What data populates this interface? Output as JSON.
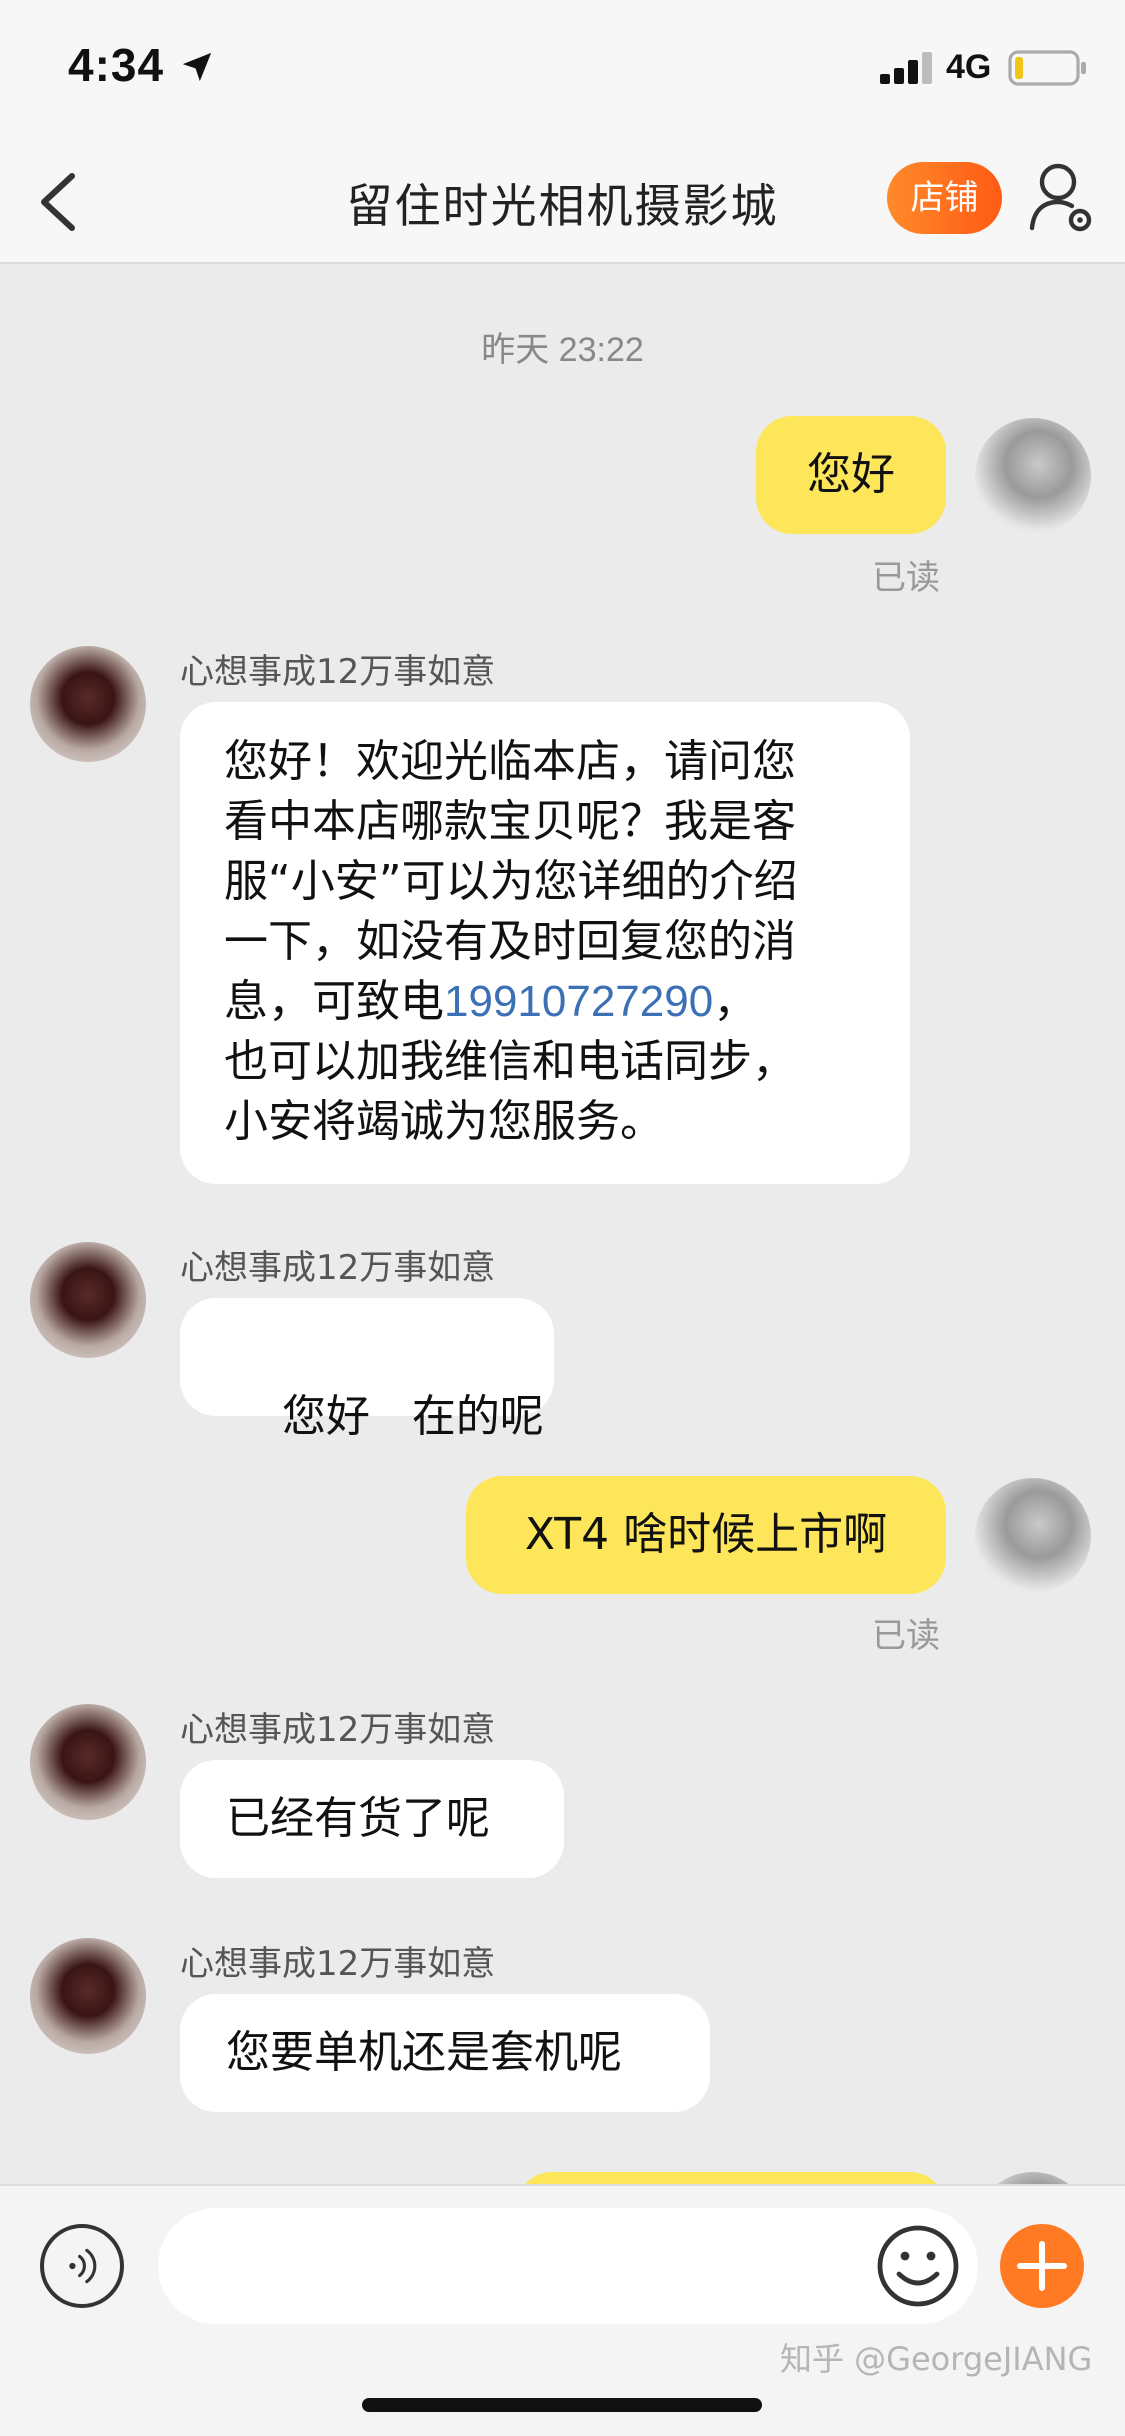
{
  "status_bar": {
    "time": "4:34",
    "network": "4G"
  },
  "nav": {
    "title": "留住时光相机摄影城",
    "shop_button": "店铺"
  },
  "chat": {
    "timestamp": "昨天 23:22",
    "messages": [
      {
        "from": "self",
        "text": "您好",
        "status": "已读"
      },
      {
        "from": "shop",
        "sender": "心想事成12万事如意",
        "lines": [
          "您好！欢迎光临本店，请问您",
          "看中本店哪款宝贝呢？我是客",
          "服“小安”可以为您详细的介绍",
          "一下，如没有及时回复您的消",
          "也可以加我维信和电话同步，",
          "小安将竭诚为您服务。"
        ],
        "line5_prefix": "息，可致电",
        "phone": "19910727290",
        "line5_suffix": "，"
      },
      {
        "from": "shop",
        "sender": "心想事成12万事如意",
        "text": "您好   在的呢"
      },
      {
        "from": "self",
        "text": "XT4 啥时候上市啊",
        "status": "已读"
      },
      {
        "from": "shop",
        "sender": "心想事成12万事如意",
        "text": "已经有货了呢"
      },
      {
        "from": "shop",
        "sender": "心想事成12万事如意",
        "text": "您要单机还是套机呢"
      }
    ]
  },
  "input_bar": {
    "placeholder": "",
    "watermark": "知乎 @GeorgeJIANG"
  },
  "colors": {
    "self_bubble": "#fde65a",
    "other_bubble": "#ffffff",
    "accent": "#ff7a22",
    "link": "#3b6fb6"
  }
}
